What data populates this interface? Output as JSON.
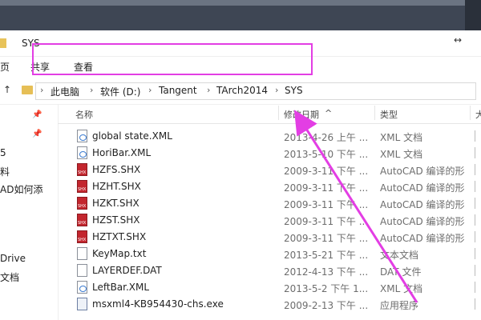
{
  "window": {
    "title": "SYS"
  },
  "ribbon": {
    "partial_tab": "页",
    "share": "共享",
    "view": "查看"
  },
  "address": {
    "crumbs": [
      "此电脑",
      "软件 (D:)",
      "Tangent",
      "TArch2014",
      "SYS"
    ]
  },
  "sidebar": {
    "items": [
      "5",
      "料",
      "AD如何添",
      "Drive",
      "文档"
    ]
  },
  "columns": {
    "name": "名称",
    "date": "修改日期",
    "type": "类型",
    "size": "大"
  },
  "files": [
    {
      "name": "global state.XML",
      "date": "2013-4-26 上午 ...",
      "type": "XML 文档",
      "icon": "xml-file-icon"
    },
    {
      "name": "HoriBar.XML",
      "date": "2013-5-10 下午 ...",
      "type": "XML 文档",
      "icon": "xml-file-icon"
    },
    {
      "name": "HZFS.SHX",
      "date": "2009-3-11 下午 ...",
      "type": "AutoCAD 编译的形",
      "icon": "shx-file-icon"
    },
    {
      "name": "HZHT.SHX",
      "date": "2009-3-11 下午 ...",
      "type": "AutoCAD 编译的形",
      "icon": "shx-file-icon"
    },
    {
      "name": "HZKT.SHX",
      "date": "2009-3-11 下午 ...",
      "type": "AutoCAD 编译的形",
      "icon": "shx-file-icon"
    },
    {
      "name": "HZST.SHX",
      "date": "2009-3-11 下午 ...",
      "type": "AutoCAD 编译的形",
      "icon": "shx-file-icon"
    },
    {
      "name": "HZTXT.SHX",
      "date": "2009-3-11 下午 ...",
      "type": "AutoCAD 编译的形",
      "icon": "shx-file-icon"
    },
    {
      "name": "KeyMap.txt",
      "date": "2013-5-21 下午 ...",
      "type": "文本文档",
      "icon": "txt-file-icon"
    },
    {
      "name": "LAYERDEF.DAT",
      "date": "2012-4-13 下午 ...",
      "type": "DAT 文件",
      "icon": "dat-file-icon"
    },
    {
      "name": "LeftBar.XML",
      "date": "2013-5-2 下午 1...",
      "type": "XML 文档",
      "icon": "xml-file-icon"
    },
    {
      "name": "msxml4-KB954430-chs.exe",
      "date": "2009-2-13 下午 ...",
      "type": "应用程序",
      "icon": "exe-file-icon"
    }
  ],
  "annotation": {
    "highlight_color": "#e33ee4",
    "arrow_color": "#e33ee4"
  }
}
